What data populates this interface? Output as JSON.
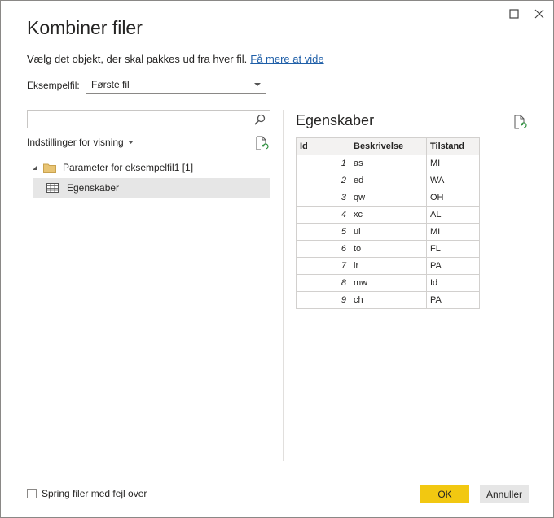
{
  "dialog": {
    "title": "Kombiner filer",
    "subtitle": "Vælg det objekt, der skal pakkes ud fra hver fil.",
    "learn_more_link": "Få mere at vide"
  },
  "sample_file": {
    "label": "Eksempelfil:",
    "selected": "Første fil"
  },
  "left_pane": {
    "search_placeholder": "",
    "view_options_label": "Indstillinger for visning",
    "tree": {
      "parent_label": "Parameter for eksempelfil1 [1]",
      "child_label": "Egenskaber"
    }
  },
  "right_pane": {
    "title": "Egenskaber",
    "table": {
      "headers": [
        "Id",
        "Beskrivelse",
        "Tilstand"
      ],
      "rows": [
        [
          "1",
          "as",
          "MI"
        ],
        [
          "2",
          "ed",
          "WA"
        ],
        [
          "3",
          "qw",
          "OH"
        ],
        [
          "4",
          "xc",
          "AL"
        ],
        [
          "5",
          "ui",
          "MI"
        ],
        [
          "6",
          "to",
          "FL"
        ],
        [
          "7",
          "lr",
          "PA"
        ],
        [
          "8",
          "mw",
          "Id"
        ],
        [
          "9",
          "ch",
          "PA"
        ]
      ]
    }
  },
  "footer": {
    "skip_errors_label": "Spring filer med fejl over",
    "skip_errors_checked": false,
    "ok_label": "OK",
    "cancel_label": "Annuller"
  },
  "colors": {
    "accent_button": "#f2c811",
    "link": "#1f5fa8",
    "selection": "#e6e6e6"
  },
  "icons": {
    "window": [
      "maximize-icon",
      "close-icon"
    ],
    "search": "search-icon",
    "refresh": "refresh-icon",
    "folder": "folder-icon",
    "table": "table-icon"
  }
}
